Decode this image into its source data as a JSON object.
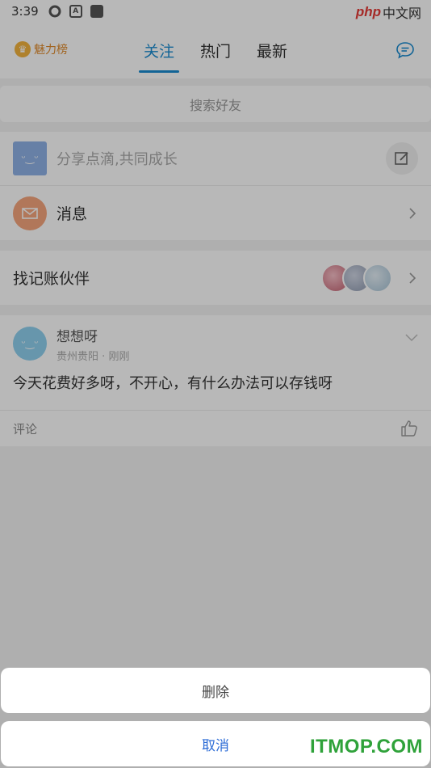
{
  "status_bar": {
    "time": "3:39",
    "badge_a": "A",
    "brand_php": "php",
    "brand_cn": "中文网"
  },
  "header": {
    "rank_label": "魅力榜",
    "tabs": [
      {
        "label": "关注",
        "active": true
      },
      {
        "label": "热门",
        "active": false
      },
      {
        "label": "最新",
        "active": false
      }
    ]
  },
  "search": {
    "placeholder": "搜索好友"
  },
  "compose": {
    "text": "分享点滴,共同成长",
    "avatar_face": "ᵕ‿ᵕ"
  },
  "messages": {
    "label": "消息"
  },
  "partner": {
    "label": "找记账伙伴"
  },
  "post": {
    "author": "想想呀",
    "location": "贵州贵阳",
    "time": "刚刚",
    "separator": "·",
    "avatar_face": "ᵕ‿ᵕ",
    "content": "今天花费好多呀，不开心，有什么办法可以存钱呀",
    "comment_label": "评论"
  },
  "action_sheet": {
    "delete_label": "删除",
    "cancel_label": "取消"
  },
  "watermark": "ITMOP.COM",
  "colors": {
    "accent": "#1a8bd0",
    "cancel": "#2b6bd6",
    "rank": "#e08a2a",
    "watermark": "#2fa23a"
  }
}
